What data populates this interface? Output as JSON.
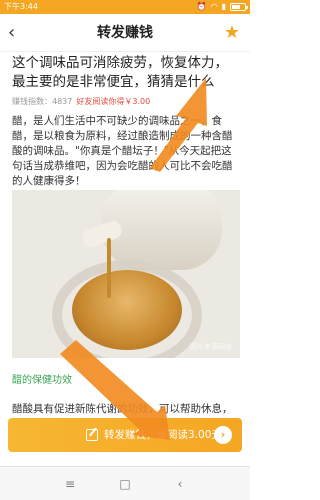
{
  "status_bar": {
    "time": "下午3:44",
    "icons": [
      "alarm-icon",
      "wifi-icon",
      "signal-icon",
      "battery-icon"
    ]
  },
  "header": {
    "back_icon": "‹",
    "title": "转发赚钱",
    "star_icon": "★"
  },
  "article": {
    "title": "这个调味品可消除疲劳，恢复体力，最主要的是非常便宜，猜猜是什么",
    "meta_label": "赚钱指数：4837",
    "meta_reward": "好友阅读你得￥3.00",
    "intro": "醋，是人们生活中不可缺少的调味品之一，食醋，是以粮食为原料，经过酿造制成的一种含醋酸的调味品。\"你真是个醋坛子！\"从今天起把这句话当成恭维吧，因为会吃醋的人可比不会吃醋的人健康得多！",
    "image_watermark": "图片来源网络",
    "section_title": "醋的保健功效",
    "body": "醋酸具有促进新陈代谢的功效，可以帮助休息，恢复体力，预防疲劳，高血压，日常"
  },
  "share_bar": {
    "label": "转发赚钱，每阅读3.00元",
    "go_icon": "›"
  },
  "nav_bar": {
    "menu_icon": "≡",
    "home_icon": "□",
    "back_icon": "‹"
  },
  "colors": {
    "status_bar": "#f5a623",
    "accent": "#f5a623",
    "reward": "#e24b3b",
    "section": "#3aa655"
  }
}
